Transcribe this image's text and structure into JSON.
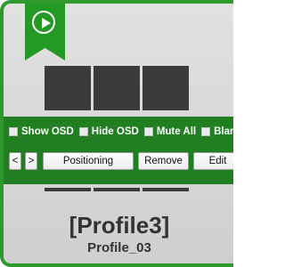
{
  "options": {
    "show_osd": "Show OSD",
    "hide_osd": "Hide OSD",
    "mute_all": "Mute All",
    "blank_all": "Blank All"
  },
  "buttons": {
    "prev": "<",
    "next": ">",
    "positioning": "Positioning",
    "remove": "Remove",
    "edit": "Edit"
  },
  "profile": {
    "title": "[Profile3]",
    "name": "Profile_03"
  },
  "ribbon_icon": "play-circle-icon",
  "colors": {
    "accent": "#2e9a2e",
    "bar": "#217f21",
    "tile": "#3b3b3b"
  }
}
